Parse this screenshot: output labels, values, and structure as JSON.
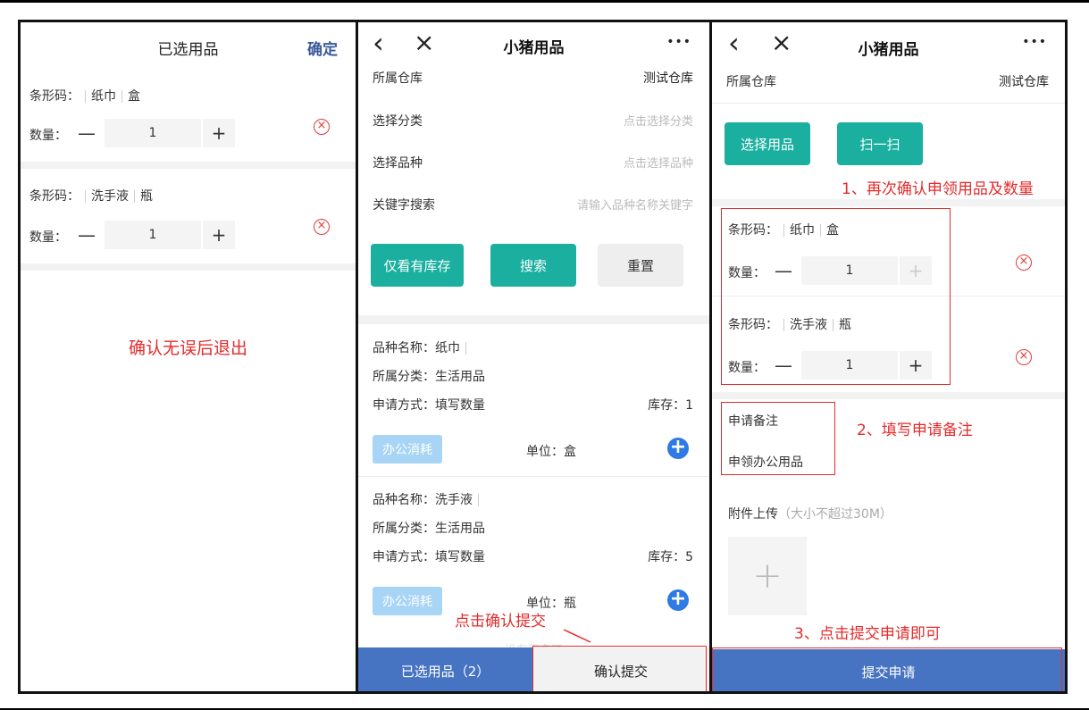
{
  "panel1": {
    "title": "已选用品",
    "confirm": "确定",
    "items": [
      {
        "barcode_label": "条形码：",
        "name": "纸巾",
        "unit": "盒",
        "qty_label": "数量：",
        "qty": "1",
        "minus": "—",
        "plus": "+",
        "delete": "×"
      },
      {
        "barcode_label": "条形码：",
        "name": "洗手液",
        "unit": "瓶",
        "qty_label": "数量：",
        "qty": "1",
        "minus": "—",
        "plus": "+",
        "delete": "×"
      }
    ],
    "annotation": "确认无误后退出"
  },
  "panel2": {
    "back": "‹",
    "close": "×",
    "title": "小猪用品",
    "more": "•••",
    "warehouse_label": "所属仓库",
    "warehouse_value": "测试仓库",
    "category_label": "选择分类",
    "category_placeholder": "点击选择分类",
    "variety_label": "选择品种",
    "variety_placeholder": "点击选择品种",
    "keyword_label": "关键字搜索",
    "keyword_placeholder": "请输入品种名称关键字",
    "btn_stock_only": "仅看有库存",
    "btn_search": "搜索",
    "btn_reset": "重置",
    "products": [
      {
        "name_line": "品种名称：纸巾",
        "category_line": "所属分类：生活用品",
        "method_line": "申请方式：填写数量",
        "stock": "库存：1",
        "tag": "办公消耗",
        "unit": "单位：盒"
      },
      {
        "name_line": "品种名称：洗手液",
        "category_line": "所属分类：生活用品",
        "method_line": "申请方式：填写数量",
        "stock": "库存：5",
        "tag": "办公消耗",
        "unit": "单位：瓶"
      }
    ],
    "no_more": "没有更多了",
    "annotation": "点击确认提交",
    "bottom_selected": "已选用品（2）",
    "bottom_submit": "确认提交"
  },
  "panel3": {
    "back": "‹",
    "close": "×",
    "title": "小猪用品",
    "more": "•••",
    "warehouse_label": "所属仓库",
    "warehouse_value": "测试仓库",
    "btn_select": "选择用品",
    "btn_scan": "扫一扫",
    "annotation1": "1、再次确认申领用品及数量",
    "items": [
      {
        "barcode_label": "条形码：",
        "name": "纸巾",
        "unit": "盒",
        "qty_label": "数量：",
        "qty": "1",
        "minus": "—",
        "plus": "+",
        "delete": "×"
      },
      {
        "barcode_label": "条形码：",
        "name": "洗手液",
        "unit": "瓶",
        "qty_label": "数量：",
        "qty": "1",
        "minus": "—",
        "plus": "+",
        "delete": "×"
      }
    ],
    "remark_label": "申请备注",
    "remark_value": "申领办公用品",
    "annotation2": "2、填写申请备注",
    "attach_label": "附件上传",
    "attach_hint": "（大小不超过30M）",
    "upload_plus": "+",
    "annotation3": "3、点击提交申请即可",
    "submit": "提交申请"
  }
}
